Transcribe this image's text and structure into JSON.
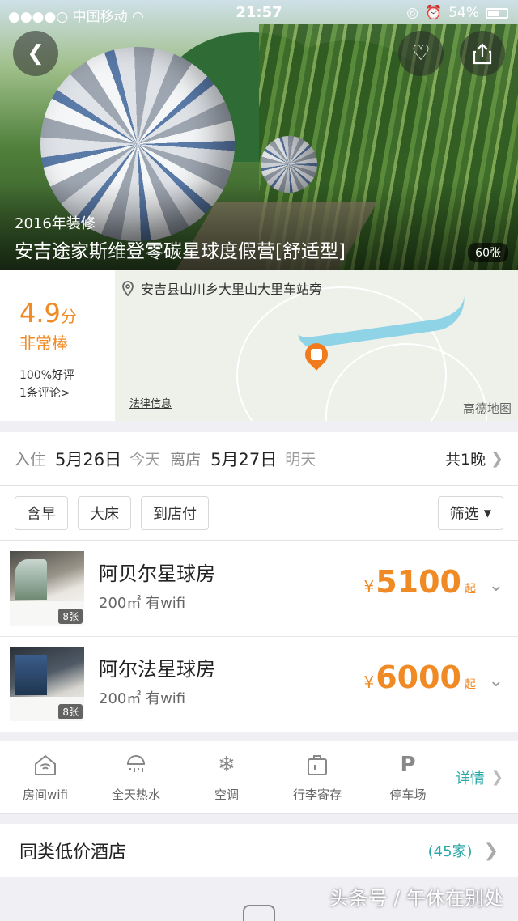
{
  "status": {
    "carrier": "●●●●○ 中国移动",
    "time": "21:57",
    "battery": "54%"
  },
  "hero": {
    "year": "2016年装修",
    "name": "安吉途家斯维登零碳星球度假营[舒适型]",
    "photo_count": "60张"
  },
  "rating": {
    "score": "4.9",
    "unit": "分",
    "label": "非常棒",
    "positive": "100%好评",
    "reviews": "1条评论>"
  },
  "map": {
    "address": "安吉县山川乡大里山大里车站旁",
    "legal": "法律信息",
    "brand": "高德地图"
  },
  "dates": {
    "checkin_label": "入住",
    "checkin": "5月26日",
    "checkin_sub": "今天",
    "checkout_label": "离店",
    "checkout": "5月27日",
    "checkout_sub": "明天",
    "nights": "共1晚"
  },
  "filters": {
    "chips": [
      "含早",
      "大床",
      "到店付"
    ],
    "filter": "筛选"
  },
  "rooms": [
    {
      "name": "阿贝尔星球房",
      "desc": "200㎡ 有wifi",
      "currency": "¥",
      "price": "5100",
      "suffix": "起",
      "photos": "8张"
    },
    {
      "name": "阿尔法星球房",
      "desc": "200㎡ 有wifi",
      "currency": "¥",
      "price": "6000",
      "suffix": "起",
      "photos": "8张"
    }
  ],
  "amenities": {
    "items": [
      {
        "label": "房间wifi",
        "icon": "house-wifi-icon"
      },
      {
        "label": "全天热水",
        "icon": "shower-icon"
      },
      {
        "label": "空调",
        "icon": "snowflake-icon"
      },
      {
        "label": "行李寄存",
        "icon": "luggage-icon"
      },
      {
        "label": "停车场",
        "icon": "parking-icon"
      }
    ],
    "more": "详情"
  },
  "similar": {
    "label": "同类低价酒店",
    "count": "(45家)"
  },
  "watermark": "头条号 / 午休在别处",
  "colors": {
    "accent": "#f08a24",
    "link": "#2aa7a7"
  }
}
